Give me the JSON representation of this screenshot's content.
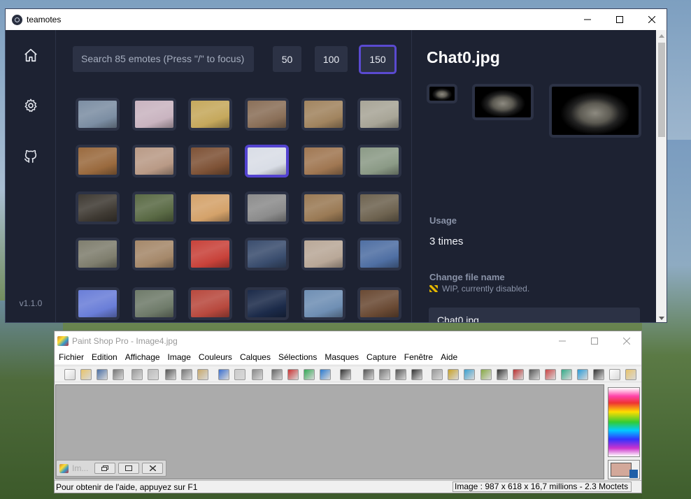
{
  "teamotes": {
    "title": "teamotes",
    "version": "v1.1.0",
    "search": {
      "placeholder": "Search 85 emotes (Press \"/\" to focus)"
    },
    "sizes": [
      {
        "label": "50"
      },
      {
        "label": "100"
      },
      {
        "label": "150",
        "active": true
      }
    ],
    "nav": [
      {
        "icon": "home-icon"
      },
      {
        "icon": "gear-icon"
      },
      {
        "icon": "github-icon"
      }
    ],
    "grid_colors": [
      [
        "#7c8ea3",
        "#c9b4c0",
        "#c5a85c",
        "#8a6f58",
        "#a1845f",
        "#a8a597"
      ],
      [
        "#9a6a3e",
        "#b99a86",
        "#7e5236",
        "#d9dde6",
        "#a07752",
        "#8b9a86"
      ],
      [
        "#3f3a33",
        "#5a6a45",
        "#d4a26a",
        "#8c8c8c",
        "#9a7a55",
        "#6e6350"
      ],
      [
        "#7f7e6e",
        "#a5886a",
        "#c8423a",
        "#3a4d6e",
        "#b9a898",
        "#4f6fa3"
      ],
      [
        "#6a7ed8",
        "#6f7b6a",
        "#b8493e",
        "#1c2b4a",
        "#6f8fb4",
        "#6a4a34"
      ]
    ],
    "selected_index": 9,
    "detail": {
      "filename": "Chat0.jpg",
      "usage_label": "Usage",
      "usage_value": "3 times",
      "change_label": "Change file name",
      "wip_note": "WIP, currently disabled.",
      "name_value": "Chat0.jpg"
    }
  },
  "psp": {
    "title": "Paint Shop Pro - Image4.jpg",
    "menu": [
      "Fichier",
      "Edition",
      "Affichage",
      "Image",
      "Couleurs",
      "Calques",
      "Sélections",
      "Masques",
      "Capture",
      "Fenêtre",
      "Aide"
    ],
    "mini_label": "Im...",
    "status_left": "Pour obtenir de l'aide, appuyez sur F1",
    "status_right": "Image : 987 x 618 x 16,7 millions - 2.3 Moctets",
    "fg_color": "#d3a89a",
    "bg_color": "#1e5fa8"
  }
}
